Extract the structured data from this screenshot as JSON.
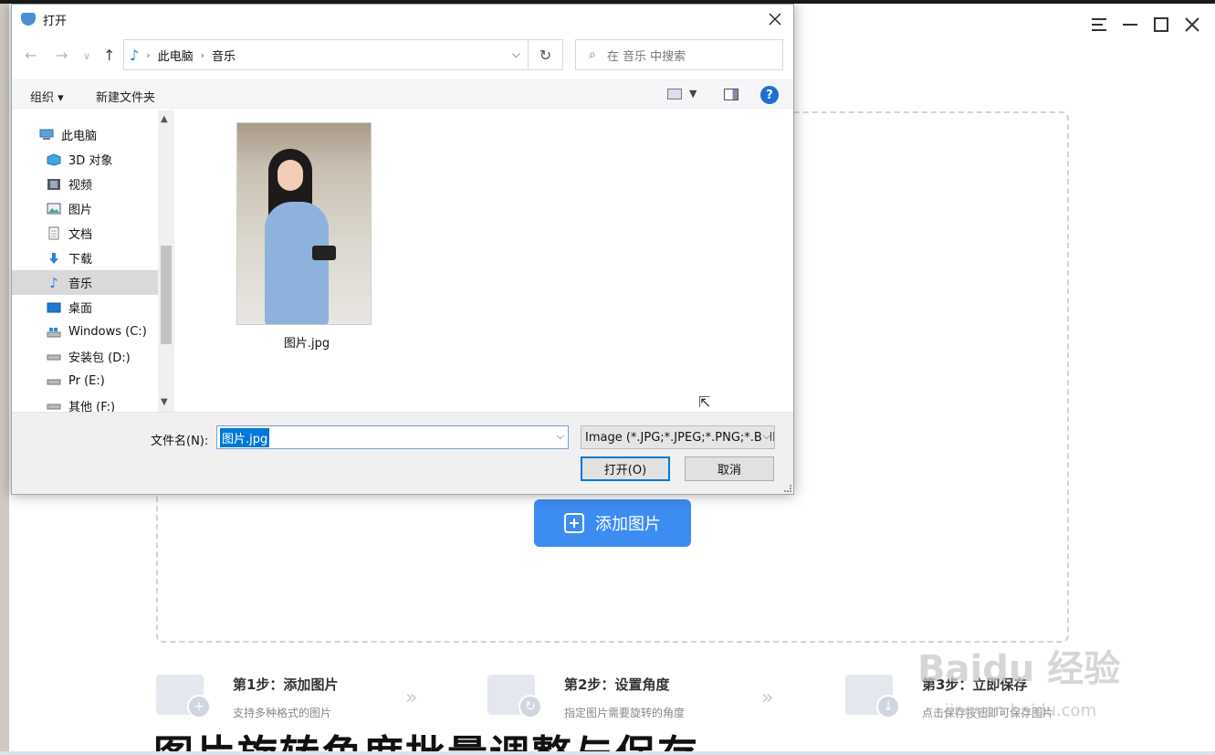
{
  "background": {
    "window_controls": [
      "menu",
      "minimize",
      "maximize",
      "close"
    ],
    "add_button_label": "添加图片",
    "steps": [
      {
        "title": "第1步：添加图片",
        "desc": "支持多种格式的图片",
        "icon": "image-add-icon"
      },
      {
        "title": "第2步：设置角度",
        "desc": "指定图片需要旋转的角度",
        "icon": "image-rotate-icon"
      },
      {
        "title": "第3步：立即保存",
        "desc": "点击保存按钮即可保存图片",
        "icon": "save-download-icon"
      }
    ],
    "big_heading": "图片旋转角度批量调整与保存",
    "watermark": "Baidu 经验",
    "watermark_sub": "jingyan.baidu.com",
    "accent_color": "#3d8cf2"
  },
  "dialog": {
    "title": "打开",
    "nav": {
      "back": "←",
      "forward": "→",
      "recent": "∨",
      "up": "↑"
    },
    "breadcrumb": [
      "此电脑",
      "音乐"
    ],
    "search_placeholder": "在 音乐 中搜索",
    "toolbar": {
      "organize": "组织 ▾",
      "new_folder": "新建文件夹",
      "help": "?"
    },
    "sidebar": [
      {
        "label": "此电脑",
        "icon": "computer-icon",
        "indent": 0,
        "selected": false
      },
      {
        "label": "3D 对象",
        "icon": "cube-3d-icon",
        "indent": 1,
        "selected": false
      },
      {
        "label": "视频",
        "icon": "video-icon",
        "indent": 1,
        "selected": false
      },
      {
        "label": "图片",
        "icon": "picture-icon",
        "indent": 1,
        "selected": false
      },
      {
        "label": "文档",
        "icon": "document-icon",
        "indent": 1,
        "selected": false
      },
      {
        "label": "下载",
        "icon": "download-icon",
        "indent": 1,
        "selected": false
      },
      {
        "label": "音乐",
        "icon": "music-icon",
        "indent": 1,
        "selected": true
      },
      {
        "label": "桌面",
        "icon": "desktop-icon",
        "indent": 1,
        "selected": false
      },
      {
        "label": "Windows (C:)",
        "icon": "drive-icon",
        "indent": 1,
        "selected": false
      },
      {
        "label": "安装包 (D:)",
        "icon": "drive-icon",
        "indent": 1,
        "selected": false
      },
      {
        "label": "Pr (E:)",
        "icon": "drive-icon",
        "indent": 1,
        "selected": false
      },
      {
        "label": "其他 (F:)",
        "icon": "drive-icon",
        "indent": 1,
        "selected": false
      }
    ],
    "files": [
      {
        "name": "图片.jpg",
        "type": "image"
      }
    ],
    "filename_label": "文件名(N):",
    "filename_value": "图片.jpg",
    "filetype_value": "Image (*.JPG;*.JPEG;*.PNG;*.BMP)",
    "open_label": "打开(O)",
    "cancel_label": "取消"
  }
}
